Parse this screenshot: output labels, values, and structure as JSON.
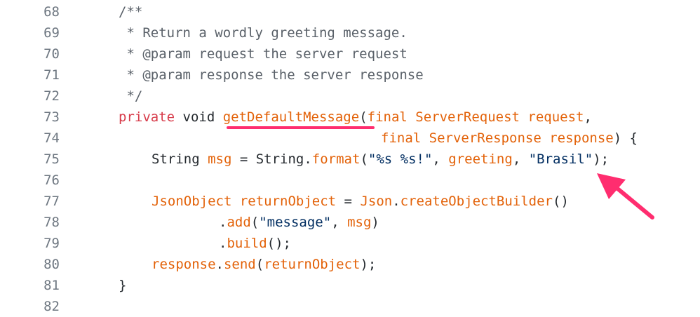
{
  "lines": [
    {
      "no": "68",
      "code": "/**"
    },
    {
      "no": "69",
      "code": " * Return a wordly greeting message."
    },
    {
      "no": "70",
      "code": " * @param request the server request"
    },
    {
      "no": "71",
      "code": " * @param response the server response"
    },
    {
      "no": "72",
      "code": " */"
    },
    {
      "no": "73",
      "t1": "private",
      "t2": " void ",
      "t3": "getDefaultMessage",
      "t4": "(",
      "t5": "final",
      "t6": " ServerRequest request",
      "t7": ","
    },
    {
      "no": "74",
      "t1": "final",
      "t2": " ServerResponse response",
      "t3": ") {"
    },
    {
      "no": "75",
      "t1": "String ",
      "t2": "msg",
      "t3": " = String.",
      "t4": "format",
      "t5": "(",
      "t6": "\"%s %s!\"",
      "t7": ", ",
      "t8": "greeting",
      "t9": ", ",
      "t10": "\"Brasil\"",
      "t11": ");"
    },
    {
      "no": "76"
    },
    {
      "no": "77",
      "t1": "JsonObject returnObject",
      "t2": " = ",
      "t3": "Json",
      "t4": ".",
      "t5": "createObjectBuilder",
      "t6": "()"
    },
    {
      "no": "78",
      "t1": ".",
      "t2": "add",
      "t3": "(",
      "t4": "\"message\"",
      "t5": ", ",
      "t6": "msg",
      "t7": ")"
    },
    {
      "no": "79",
      "t1": ".",
      "t2": "build",
      "t3": "();"
    },
    {
      "no": "80",
      "t1": "response",
      "t2": ".",
      "t3": "send",
      "t4": "(",
      "t5": "returnObject",
      "t6": ");"
    },
    {
      "no": "81",
      "code": "}"
    },
    {
      "no": "82"
    }
  ],
  "colors": {
    "keyword": "#d73a49",
    "comment": "#5a6169",
    "identifier": "#e36209",
    "string": "#032f62",
    "annotation": "#ff2d6f"
  }
}
